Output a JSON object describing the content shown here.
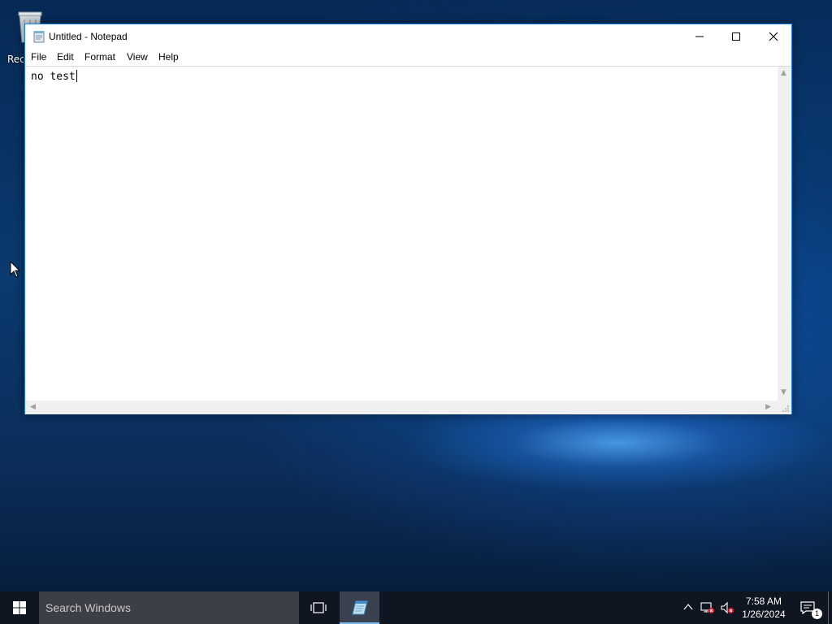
{
  "desktop": {
    "recycle_bin_label": "Recycle Bin"
  },
  "window": {
    "title": "Untitled - Notepad",
    "menu": [
      "File",
      "Edit",
      "Format",
      "View",
      "Help"
    ],
    "text_content": "no test"
  },
  "taskbar": {
    "search_placeholder": "Search Windows",
    "clock_time": "7:58 AM",
    "clock_date": "1/26/2024",
    "notification_count": "1"
  },
  "icons": {
    "start": "windows-logo-icon",
    "task_view": "task-view-icon",
    "notepad": "notepad-icon",
    "tray_up": "chevron-up-icon",
    "network": "network-icon",
    "volume": "volume-muted-icon",
    "action_center": "action-center-icon"
  },
  "colors": {
    "window_border": "#1883d7",
    "taskbar": "#101522",
    "search_box": "#3c3f46",
    "active_underline": "#7fb8ea"
  }
}
